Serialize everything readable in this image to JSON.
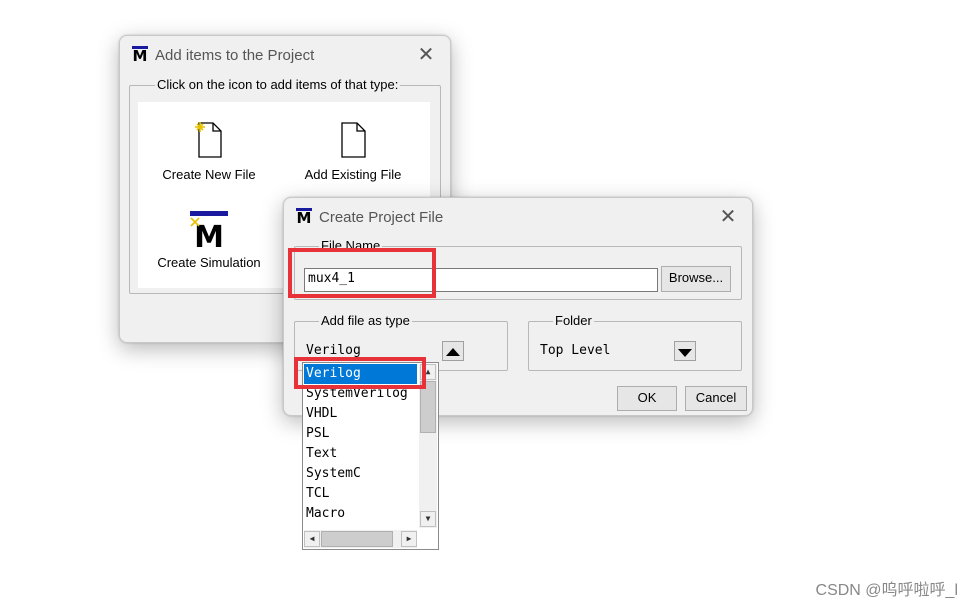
{
  "add_dialog": {
    "title": "Add items to the Project",
    "group_label": "Click on the icon to add items of that type:",
    "items": [
      {
        "label": "Create New File",
        "icon": "new-file-icon"
      },
      {
        "label": "Add Existing File",
        "icon": "file-icon"
      },
      {
        "label": "Create Simulation",
        "icon": "modelsim-icon"
      }
    ]
  },
  "create_dialog": {
    "title": "Create Project File",
    "file_name_label": "File Name",
    "file_name_value": "mux4_1",
    "browse_label": "Browse...",
    "type_group_label": "Add file as type",
    "type_selected": "Verilog",
    "folder_group_label": "Folder",
    "folder_value": "Top Level",
    "ok_label": "OK",
    "cancel_label": "Cancel"
  },
  "type_list": {
    "options": [
      "Verilog",
      "SystemVerilog",
      "VHDL",
      "PSL",
      "Text",
      "SystemC",
      "TCL",
      "Macro"
    ],
    "selected_index": 0
  },
  "app_logo_letter": "M",
  "watermark": "CSDN @呜呼啦呼_l",
  "colors": {
    "highlight_red": "#e8323a",
    "selection_blue": "#0078d7",
    "logo_bar": "#1a1aa0"
  }
}
